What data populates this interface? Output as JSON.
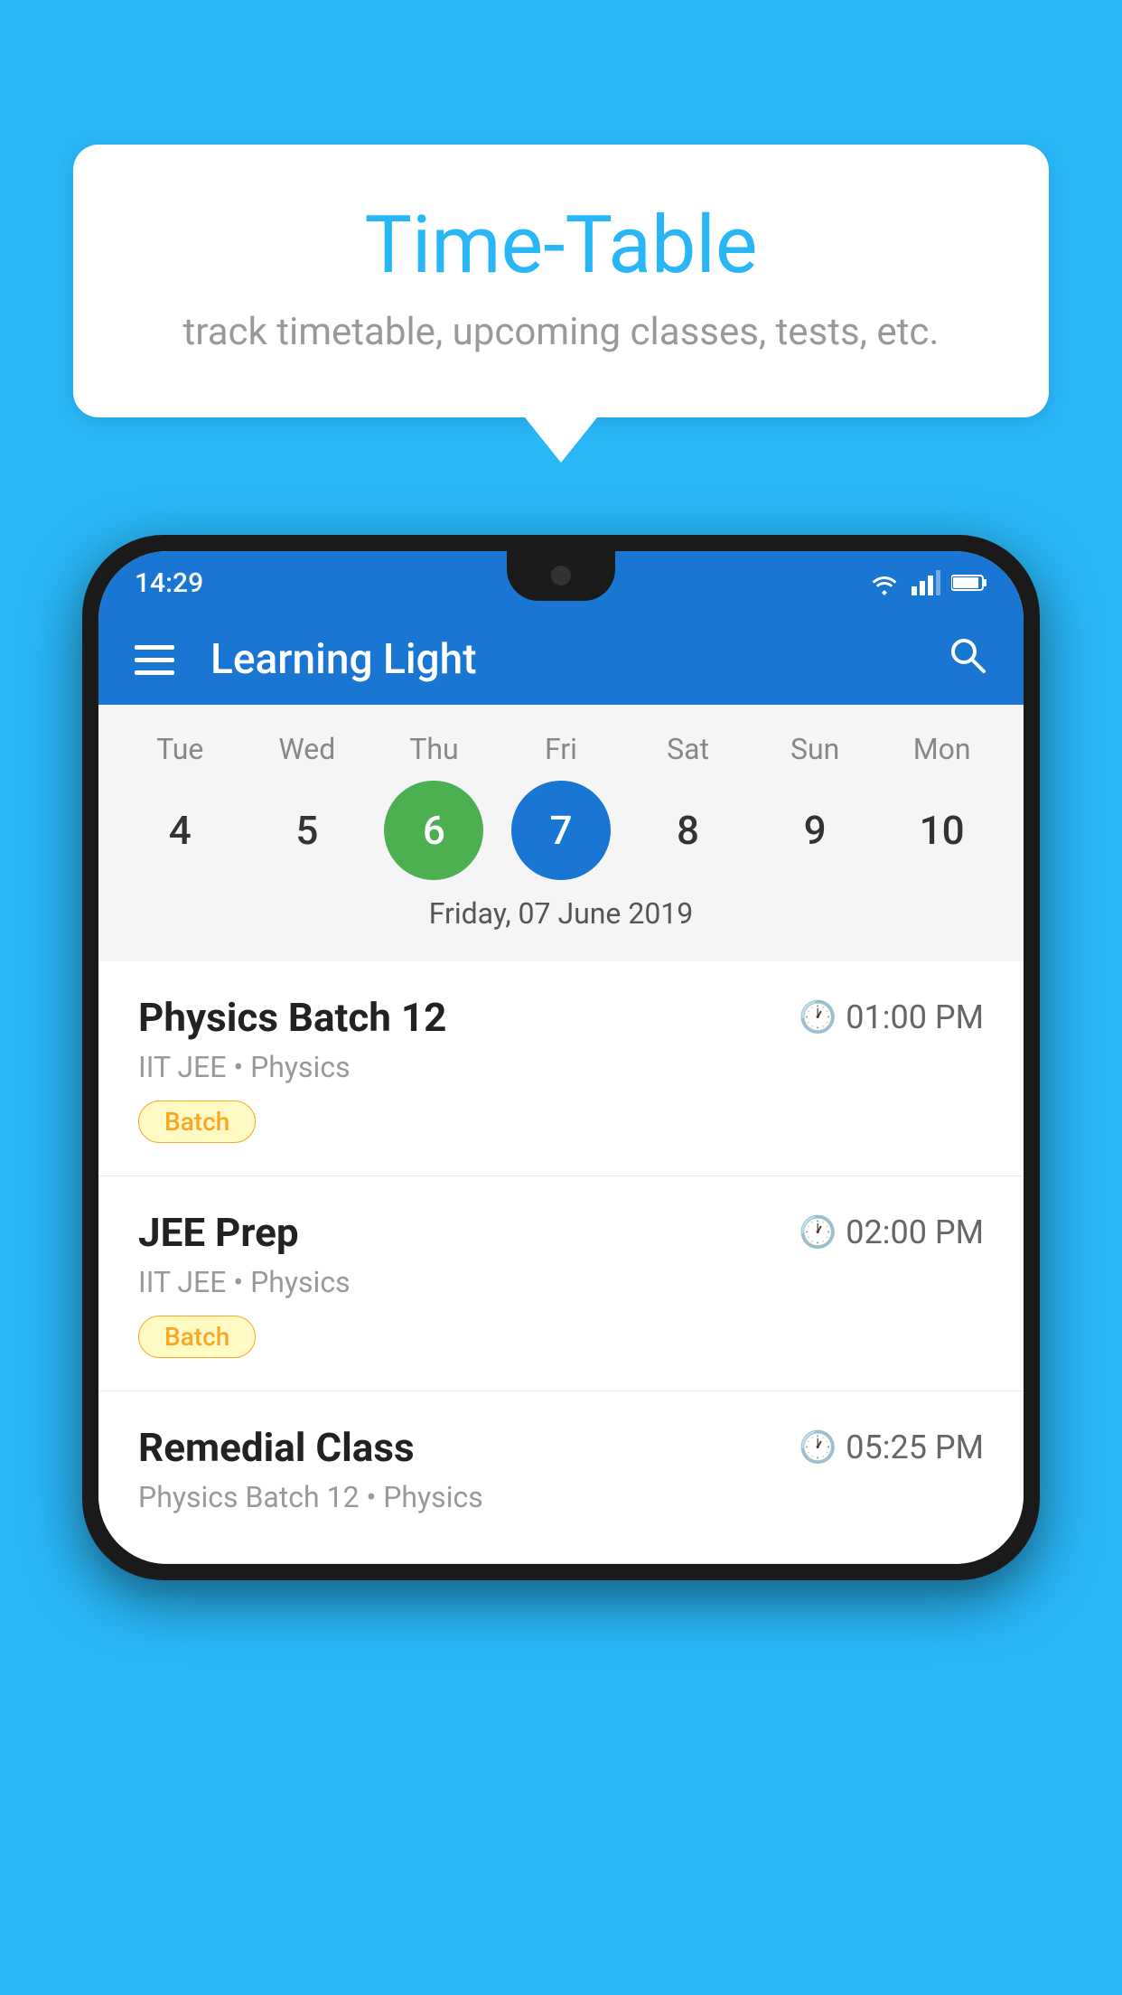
{
  "background": {
    "color": "#29B6F6"
  },
  "speech_bubble": {
    "title": "Time-Table",
    "subtitle": "track timetable, upcoming classes, tests, etc."
  },
  "phone": {
    "status_bar": {
      "time": "14:29",
      "icons": [
        "wifi",
        "signal",
        "battery"
      ]
    },
    "app_bar": {
      "title": "Learning Light",
      "menu_icon": "menu-icon",
      "search_icon": "search-icon"
    },
    "calendar": {
      "days": [
        {
          "label": "Tue",
          "number": "4"
        },
        {
          "label": "Wed",
          "number": "5"
        },
        {
          "label": "Thu",
          "number": "6",
          "state": "today"
        },
        {
          "label": "Fri",
          "number": "7",
          "state": "selected"
        },
        {
          "label": "Sat",
          "number": "8"
        },
        {
          "label": "Sun",
          "number": "9"
        },
        {
          "label": "Mon",
          "number": "10"
        }
      ],
      "selected_date_label": "Friday, 07 June 2019"
    },
    "classes": [
      {
        "name": "Physics Batch 12",
        "time": "01:00 PM",
        "meta": "IIT JEE • Physics",
        "badge": "Batch"
      },
      {
        "name": "JEE Prep",
        "time": "02:00 PM",
        "meta": "IIT JEE • Physics",
        "badge": "Batch"
      },
      {
        "name": "Remedial Class",
        "time": "05:25 PM",
        "meta": "Physics Batch 12 • Physics",
        "badge": null
      }
    ]
  }
}
